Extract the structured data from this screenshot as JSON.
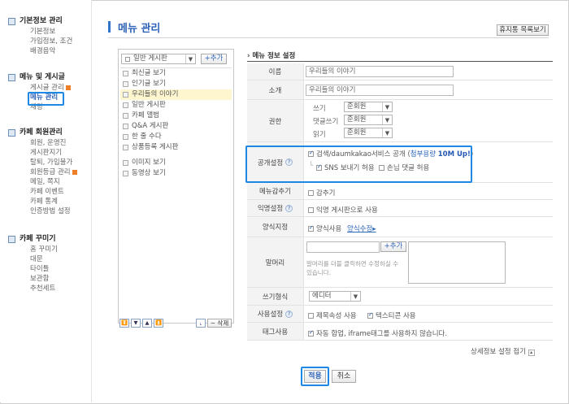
{
  "sidebar": {
    "sections": [
      {
        "title": "기본정보 관리",
        "items": [
          "기본정보",
          "가입정보, 조건",
          "배경음악"
        ]
      },
      {
        "title": "메뉴 및 게시글",
        "items": [
          "게시글 관리",
          "메뉴 관리",
          "채팅"
        ]
      },
      {
        "title": "카페 회원관리",
        "items": [
          "회원, 운영진",
          "게시판지기",
          "탈퇴, 가입불가",
          "회원등급 관리",
          "메일, 쪽지",
          "카페 이벤트",
          "카페 통계",
          "인증방법 설정"
        ]
      },
      {
        "title": "카페 꾸미기",
        "items": [
          "홈 꾸미기",
          "대문",
          "타이틀",
          "보관함",
          "추천세트"
        ]
      }
    ]
  },
  "header": {
    "title": "메뉴 관리",
    "trash_button": "휴지통 목록보기"
  },
  "tree": {
    "board_type": "일반 게시판",
    "add_button": "+추가",
    "items": [
      "최신글 보기",
      "인기글 보기",
      "우리들의 이야기",
      "일반 게시판",
      "카페 앨범",
      "Q&A 게시판",
      "한 줄 수다",
      "상품등록 게시판",
      "이미지 보기",
      "동영상 보기"
    ],
    "delete_button": "− 삭제"
  },
  "settings": {
    "heading": "메뉴 정보 설정",
    "name_label": "이름",
    "name_value": "우리들의 이야기",
    "intro_label": "소개",
    "intro_value": "우리들의 이야기",
    "perm_label": "권한",
    "perm_write_label": "쓰기",
    "perm_write_value": "준회원",
    "perm_comment_label": "댓글쓰기",
    "perm_comment_value": "준회원",
    "perm_read_label": "읽기",
    "perm_read_value": "준회원",
    "public_label": "공개설정",
    "public_main_text": "검색/daumkakao서비스 공개 (",
    "public_capacity_label": "첨부용량",
    "public_capacity_value": "10M Up!",
    "public_close": ")",
    "public_sns": "SNS 보내기 허용",
    "public_guest": "손님 댓글 허용",
    "hide_label": "메뉴감추기",
    "hide_text": "감추기",
    "anon_label": "익명설정",
    "anon_text": "익명 게시판으로 사용",
    "form_label": "양식지정",
    "form_text": "양식사용",
    "form_link": "양식수정",
    "head_label": "말머리",
    "head_add": "+추가",
    "head_help": "말머리를 더블 클릭하면 수정하실 수 있습니다.",
    "write_label": "쓰기형식",
    "write_value": "에디터",
    "use_label": "사용설정",
    "use_title_text": "제목속성 사용",
    "use_emoticon_text": "텍스티콘 사용",
    "tag_label": "태그사용",
    "tag_text": "자동 합업, iframe태그를 사용하지 않습니다.",
    "detail_toggle": "상세정보 설정 접기"
  },
  "footer": {
    "apply": "적용",
    "cancel": "취소"
  },
  "colors": {
    "accent": "#1e88e5",
    "title": "#2f63b8",
    "highlight_row": "#fdf6cf"
  }
}
